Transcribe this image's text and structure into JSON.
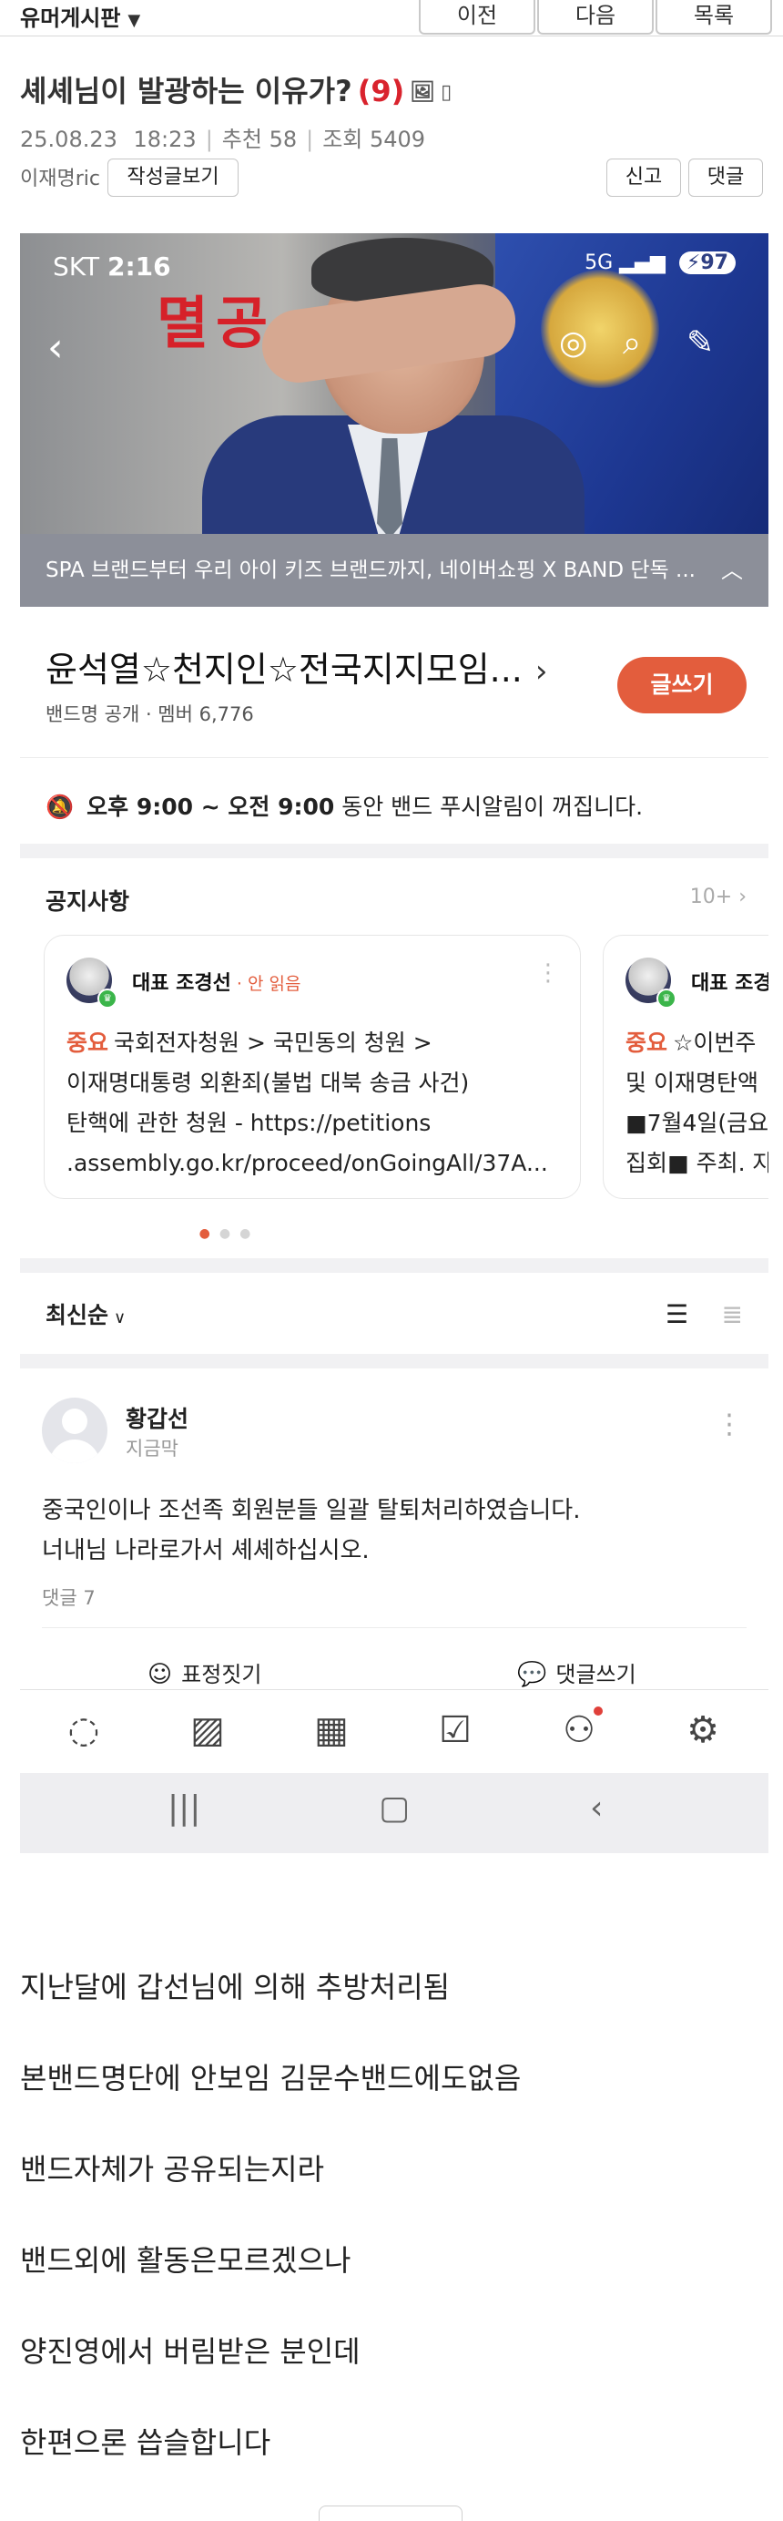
{
  "board": {
    "name": "유머게시판",
    "nav": {
      "prev": "이전",
      "next": "다음",
      "list": "목록"
    }
  },
  "post": {
    "title": "셰셰님이 발광하는 이유가?",
    "comment_count": "(9)",
    "date": "25.08.23",
    "time": "18:23",
    "recommend": "추천 58",
    "views": "조회 5409",
    "author": "이재명ric",
    "author_posts_button": "작성글보기",
    "report_button": "신고",
    "reply_button": "댓글"
  },
  "screenshot": {
    "carrier": "SKT",
    "clock": "2:16",
    "network": "5G",
    "battery": "97",
    "hero_caption": "멸공",
    "banner": "SPA 브랜드부터 우리 아이 키즈 브랜드까지, 네이버쇼핑 X BAND 단독 ...",
    "band_title": "윤석열☆천지인☆전국지지모임...",
    "band_meta": "밴드명 공개 · 멤버 6,776",
    "write_button": "글쓰기",
    "push_notice": {
      "time_range": "오후 9:00 ~ 오전 9:00",
      "text": "동안 밴드 푸시알림이 꺼집니다."
    },
    "notices": {
      "heading": "공지사항",
      "more": "10+",
      "cards": [
        {
          "author": "대표 조경선",
          "status": "· 안 읽음",
          "tag": "중요",
          "text": "국회전자청원 > 국민동의 청원 >\n이재명대통령 외환죄(불법 대북 송금 사건)\n탄핵에 관한 청원 - https://petitions\n.assembly.go.kr/proceed/onGoingAll/37A..."
        },
        {
          "author": "대표 조경",
          "tag": "중요",
          "text": "☆이번주\n및 이재명탄액\n■7월4일(금요\n집회■ 주최. 자"
        }
      ]
    },
    "sort": "최신순",
    "feed_post": {
      "author": "황갑선",
      "time": "지금막",
      "body": "중국인이나 조선족 회원분들 일괄 탈퇴처리하였습니다.\n너내님 나라로가서 셰셰하십시오.",
      "comments": "댓글 7",
      "emote_action": "표정짓기",
      "comment_action": "댓글쓰기"
    },
    "tabs": [
      "chat-icon",
      "photo-icon",
      "calendar-icon",
      "check-folder-icon",
      "members-icon",
      "settings-icon"
    ]
  },
  "body_lines": [
    "지난달에 갑선님에 의해 추방처리됨",
    "본밴드명단에 안보임 김문수밴드에도없음",
    "밴드자체가 공유되는지라",
    "밴드외에 활동은모르겠으나",
    "양진영에서 버림받은 분인데",
    "한편으론 씁슬합니다"
  ],
  "colors": {
    "accent": "#e35d3d",
    "title_count": "#d9232d",
    "banner": "#8c8f99"
  }
}
